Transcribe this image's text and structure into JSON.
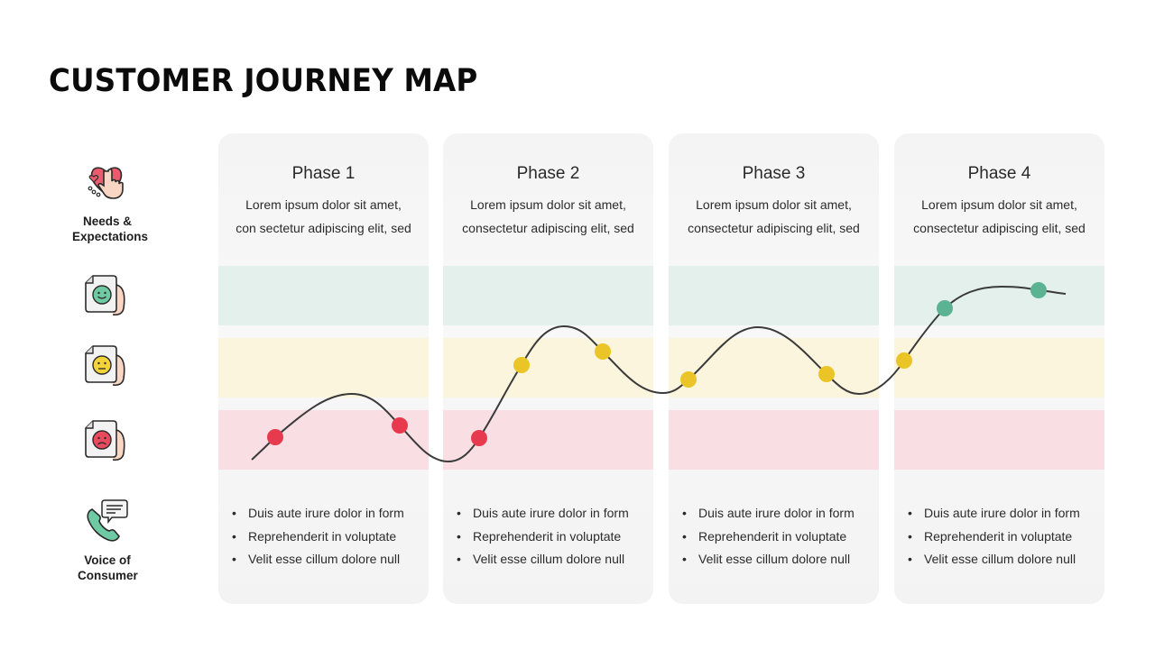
{
  "title": "CUSTOMER JOURNEY MAP",
  "row_labels": {
    "needs": "Needs & Expectations",
    "voice": "Voice of Consumer"
  },
  "emotion_rows": [
    {
      "name": "positive",
      "icon": "happy-face-document-icon",
      "band_color": "#e3f0eb",
      "dot_color": "#5cb394"
    },
    {
      "name": "neutral",
      "icon": "neutral-face-document-icon",
      "band_color": "#fbf5dd",
      "dot_color": "#ebc528"
    },
    {
      "name": "negative",
      "icon": "sad-face-document-icon",
      "band_color": "#f9dfe3",
      "dot_color": "#e83a4f"
    }
  ],
  "phases": [
    {
      "title": "Phase 1",
      "desc_line1": "Lorem ipsum dolor sit amet,",
      "desc_line2": "con sectetur adipiscing elit, sed",
      "bullets": [
        "Duis aute irure dolor in form",
        "Reprehenderit in voluptate",
        "Velit esse cillum dolore null"
      ]
    },
    {
      "title": "Phase 2",
      "desc_line1": "Lorem ipsum dolor sit amet,",
      "desc_line2": "consectetur adipiscing elit, sed",
      "bullets": [
        "Duis aute irure dolor in form",
        "Reprehenderit in voluptate",
        "Velit esse cillum dolore null"
      ]
    },
    {
      "title": "Phase 3",
      "desc_line1": "Lorem ipsum dolor sit amet,",
      "desc_line2": "consectetur adipiscing elit, sed",
      "bullets": [
        "Duis aute irure dolor in form",
        "Reprehenderit in voluptate",
        "Velit esse cillum dolore null"
      ]
    },
    {
      "title": "Phase 4",
      "desc_line1": "Lorem ipsum dolor sit amet,",
      "desc_line2": "consectetur adipiscing elit, sed",
      "bullets": [
        "Duis aute irure dolor in form",
        "Reprehenderit in voluptate",
        "Velit esse cillum dolore null"
      ]
    }
  ],
  "journey_points": [
    {
      "phase": 1,
      "emotion": "negative"
    },
    {
      "phase": 1,
      "emotion": "negative"
    },
    {
      "phase": 2,
      "emotion": "negative"
    },
    {
      "phase": 2,
      "emotion": "neutral"
    },
    {
      "phase": 2,
      "emotion": "neutral"
    },
    {
      "phase": 3,
      "emotion": "neutral"
    },
    {
      "phase": 3,
      "emotion": "neutral"
    },
    {
      "phase": 4,
      "emotion": "neutral"
    },
    {
      "phase": 4,
      "emotion": "positive"
    },
    {
      "phase": 4,
      "emotion": "positive"
    }
  ],
  "colors": {
    "curve": "#3a3a3a",
    "card_bg": "#f5f5f5"
  }
}
